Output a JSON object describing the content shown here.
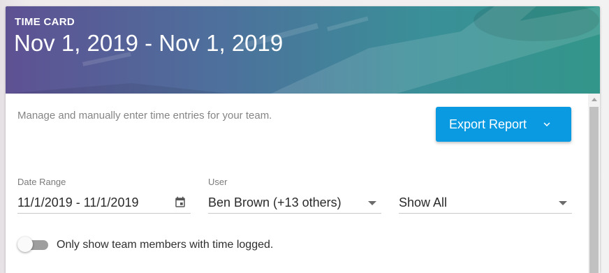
{
  "header": {
    "eyebrow": "TIME CARD",
    "title": "Nov 1, 2019 - Nov 1, 2019"
  },
  "content": {
    "description": "Manage and manually enter time entries for your team.",
    "export_button": {
      "label": "Export Report",
      "icon": "chevron-down-icon"
    }
  },
  "filters": {
    "date_range": {
      "label": "Date Range",
      "value": "11/1/2019 - 11/1/2019",
      "icon": "calendar-icon"
    },
    "user": {
      "label": "User",
      "value": "Ben Brown (+13 others)"
    },
    "show": {
      "value": "Show All"
    }
  },
  "toggle": {
    "label": "Only show team members with time logged.",
    "checked": false
  },
  "colors": {
    "accent": "#0a9ae2",
    "header_start": "#5e5193",
    "header_end": "#33968a"
  }
}
